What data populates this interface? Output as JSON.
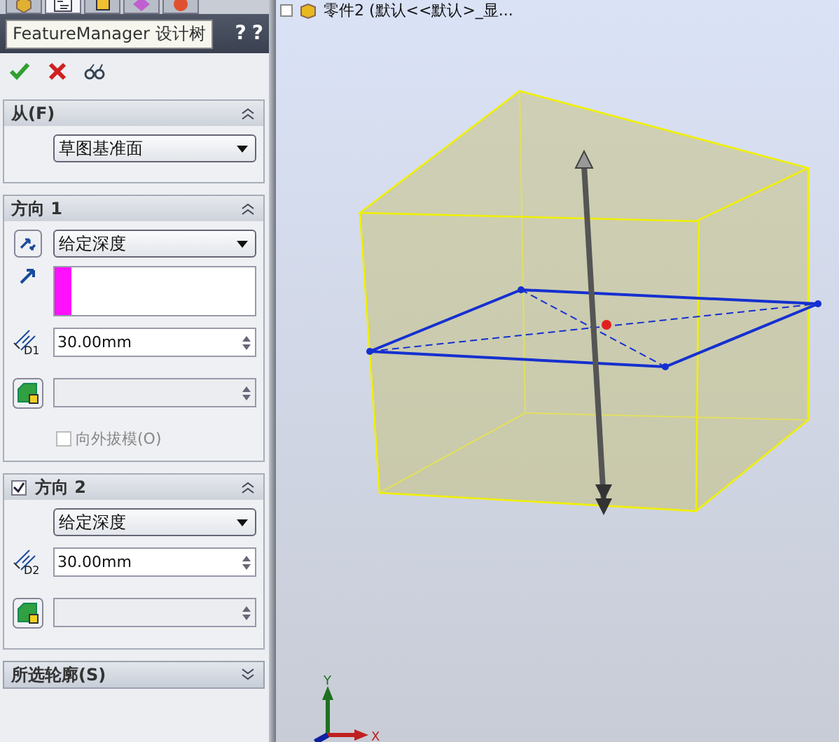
{
  "tabs": [
    {
      "kind": "part",
      "selected": false
    },
    {
      "kind": "tree",
      "selected": true
    },
    {
      "kind": "config",
      "selected": false
    },
    {
      "kind": "dimxpert",
      "selected": false
    },
    {
      "kind": "display",
      "selected": false
    }
  ],
  "tooltip": "FeatureManager 设计树",
  "help": [
    "?",
    "?"
  ],
  "sections": [
    {
      "kind": "from",
      "title": "从(F)",
      "expanded": true,
      "dropdown": "草图基准面"
    },
    {
      "kind": "direction",
      "title": "方向 1",
      "expanded": true,
      "dropdown": "给定深度",
      "depth": "30.00mm",
      "depth_tag": "D1",
      "draft": {
        "label": "向外拔模(O)",
        "checked": false
      }
    },
    {
      "kind": "direction",
      "title": "方向 2",
      "checked": true,
      "expanded": true,
      "dropdown": "给定深度",
      "depth": "30.00mm",
      "depth_tag": "D2"
    },
    {
      "kind": "contours",
      "title": "所选轮廓(S)",
      "expanded": false
    }
  ],
  "viewport": {
    "tree_item": "零件2 (默认<<默认>_显...",
    "axes": [
      "Y",
      "X"
    ]
  }
}
